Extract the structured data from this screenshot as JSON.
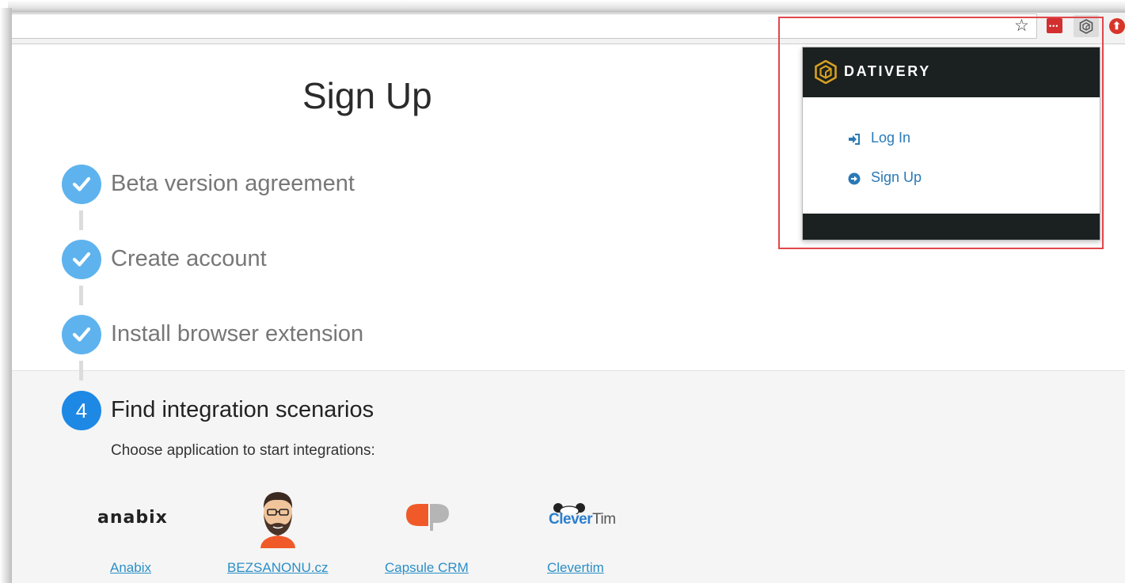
{
  "toolbar": {
    "star_icon": "star-outline-icon",
    "ext_red_icon": "lastpass-dots-icon",
    "ext_dativery_icon": "dativery-cube-icon",
    "ext_abp_icon": "adblock-stop-icon"
  },
  "page": {
    "title": "Sign Up",
    "steps": [
      {
        "label": "Beta version agreement",
        "status": "done"
      },
      {
        "label": "Create account",
        "status": "done"
      },
      {
        "label": "Install browser extension",
        "status": "done"
      },
      {
        "label": "Find integration scenarios",
        "status": "active",
        "number": "4"
      }
    ],
    "choose_text": "Choose application to start integrations:",
    "apps": [
      {
        "name": "Anabix",
        "logo_text": "anabix"
      },
      {
        "name": "BEZSANONU.cz",
        "logo_text": ""
      },
      {
        "name": "Capsule CRM",
        "logo_text": ""
      },
      {
        "name": "Clevertim",
        "logo_text": "CleverTim"
      }
    ]
  },
  "popup": {
    "brand": "DATIVERY",
    "items": [
      {
        "label": "Log In",
        "icon": "sign-in-icon"
      },
      {
        "label": "Sign Up",
        "icon": "arrow-circle-right-icon"
      }
    ]
  },
  "colors": {
    "accent": "#1e88e5",
    "step_done": "#5eb3ee",
    "link": "#2a79b6",
    "popup_dark": "#1b2020",
    "highlight": "#e0474c",
    "brand_gold": "#d6a020"
  }
}
